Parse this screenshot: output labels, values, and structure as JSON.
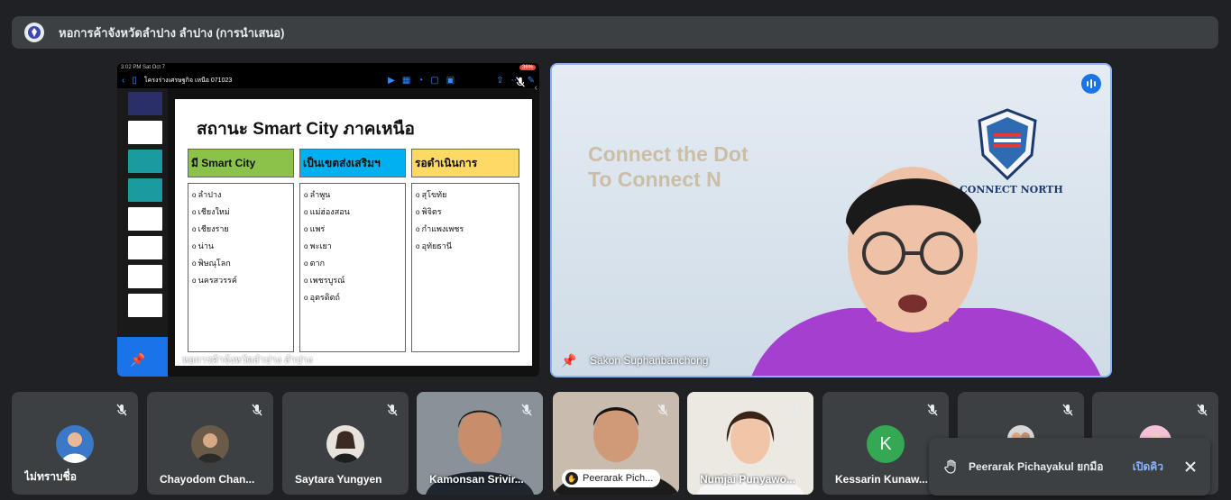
{
  "header": {
    "title": "หอการค้าจังหวัดลำปาง ลำปาง (การนำเสนอ)"
  },
  "share": {
    "status_time": "3:02 PM  Sat Oct 7",
    "status_battery": "36%",
    "doc_title": "โครงร่างเศรษฐกิจ เหนือ 071023",
    "caption": "หอการค้าจังหวัดลำปาง ลำปาง",
    "slide": {
      "title": "สถานะ Smart City ภาคเหนือ",
      "columns": [
        {
          "header": "มี Smart City",
          "color": "#8bc34a",
          "items": [
            "ลำปาง",
            "เชียงใหม่",
            "เชียงราย",
            "น่าน",
            "พิษณุโลก",
            "นครสวรรค์"
          ]
        },
        {
          "header": "เป็นเขตส่งเสริมฯ",
          "color": "#00b0f0",
          "items": [
            "ลำพูน",
            "แม่ฮ่องสอน",
            "แพร่",
            "พะเยา",
            "ตาก",
            "เพชรบูรณ์",
            "อุตรดิตถ์"
          ]
        },
        {
          "header": "รอดำเนินการ",
          "color": "#ffd966",
          "items": [
            "สุโขทัย",
            "พิจิตร",
            "กำแพงเพชร",
            "อุทัยธานี"
          ]
        }
      ]
    }
  },
  "speaker": {
    "name": "Sakon Suphanbanchong",
    "bg_text_1": "Connect the Dot",
    "bg_text_2": "To Connect N",
    "brand": "CONNECT NORTH"
  },
  "participants": [
    {
      "name": "ไม่ทราบชื่อ"
    },
    {
      "name": "Chayodom Chan..."
    },
    {
      "name": "Saytara Yungyen"
    },
    {
      "name": "Kamonsan Srivir..."
    },
    {
      "name": "Peerarak Pich..."
    },
    {
      "name": "Numjai Punyawo..."
    },
    {
      "name": "Kessarin Kunaw...",
      "initial": "K"
    },
    {
      "name": ""
    },
    {
      "name": ""
    }
  ],
  "toast": {
    "message": "Peerarak Pichayakul ยกมือ",
    "action": "เปิดคิว"
  },
  "colors": {
    "background": "#202124",
    "tile": "#3c4043",
    "accent": "#8ab4f8",
    "active_blue": "#1a73e8",
    "avatar_k": "#34a853"
  }
}
